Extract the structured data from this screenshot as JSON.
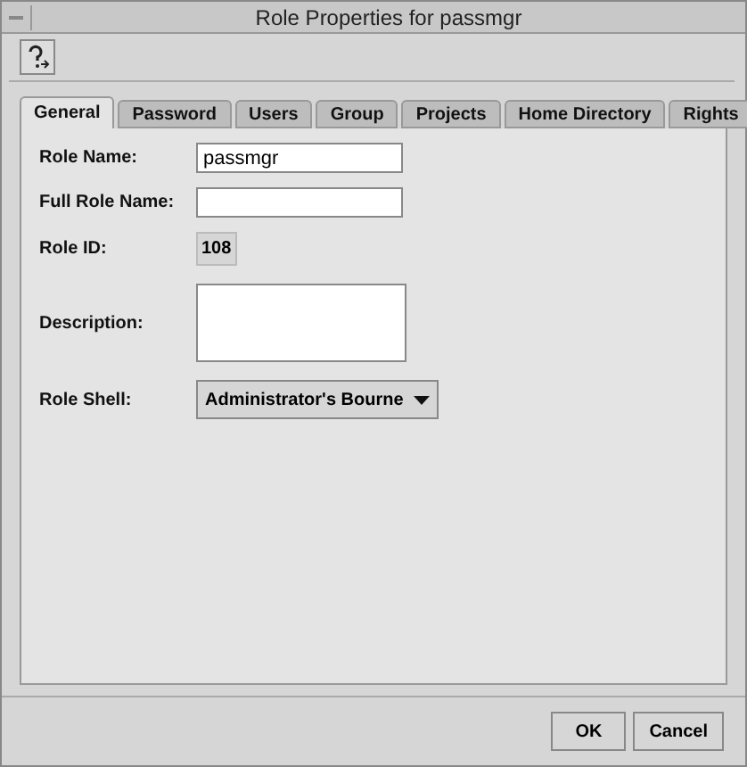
{
  "window": {
    "title": "Role Properties for passmgr"
  },
  "tabs": [
    {
      "label": "General",
      "selected": true
    },
    {
      "label": "Password",
      "selected": false
    },
    {
      "label": "Users",
      "selected": false
    },
    {
      "label": "Group",
      "selected": false
    },
    {
      "label": "Projects",
      "selected": false
    },
    {
      "label": "Home Directory",
      "selected": false
    },
    {
      "label": "Rights",
      "selected": false
    }
  ],
  "fields": [
    {
      "kind": "text",
      "label": "Role Name:",
      "value": "passmgr"
    },
    {
      "kind": "text",
      "label": "Full Role Name:"
    },
    {
      "kind": "readonly",
      "label": "Role ID:",
      "value": "108"
    },
    {
      "kind": "textarea",
      "label": "Description:"
    },
    {
      "kind": "select",
      "label": "Role Shell:",
      "value": "Administrator's Bourne"
    }
  ],
  "buttons": [
    "OK",
    "Cancel"
  ]
}
